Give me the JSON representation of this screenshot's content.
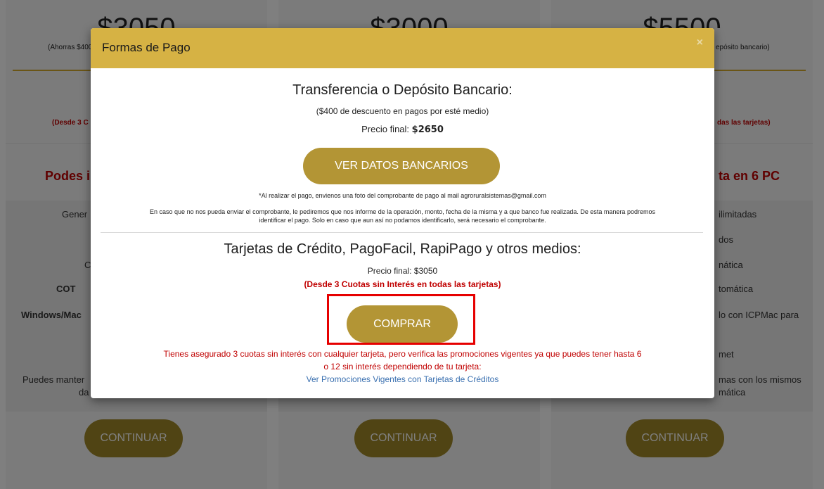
{
  "background": {
    "cards": [
      {
        "price": "$3050",
        "subnote": "(Ahorras $400",
        "rednote": "(Desde 3 C",
        "heading": "Podes i",
        "features": [
          "Gener",
          "C",
          "COT",
          "Windows/Mac",
          "Puedes manter",
          "da"
        ],
        "button": "CONTINUAR"
      },
      {
        "price": "$3000",
        "subnote": "",
        "rednote": "",
        "heading": "",
        "features": [],
        "button": "CONTINUAR"
      },
      {
        "price": "$5500",
        "subnote": "epósito bancario)",
        "rednote": "das las tarjetas)",
        "heading": "ta en 6 PC",
        "features": [
          "ilimitadas",
          "dos",
          "nática",
          "tomática",
          "lo con ICPMac para",
          "met",
          "mas con los mismos",
          "mática"
        ],
        "button": "CONTINUAR"
      }
    ]
  },
  "modal": {
    "title": "Formas de Pago",
    "close": "×",
    "transfer": {
      "title": "Transferencia o Depósito Bancario:",
      "discount": "($400 de descuento en pagos por esté medio)",
      "final_label": "Precio final: ",
      "final_value": "$2650",
      "button": "VER DATOS BANCARIOS",
      "note1": "*Al realizar el pago, envienos una foto del comprobante de pago al mail agroruralsistemas@gmail.com",
      "note2a": "En caso que no nos pueda enviar el comprobante, le pediremos que nos informe de la operación, monto, fecha de la misma y a que banco fue realizada. De esta manera podremos",
      "note2b": "identificar el pago. Solo en caso que aun así no podamos identificarlo, será necesario el comprobante."
    },
    "cards": {
      "title": "Tarjetas de Crédito, PagoFacil, RapiPago y otros medios:",
      "final": "Precio final: $3050",
      "installments": "(Desde 3 Cuotas sin Interés en todas las tarjetas)",
      "button": "COMPRAR",
      "warning1": "Tienes asegurado 3 cuotas sin interés con cualquier tarjeta, pero verifica las promociones vigentes ya que puedes tener hasta 6",
      "warning2": "o 12 sin interés dependiendo de tu tarjeta:",
      "promo_link": "Ver Promociones Vigentes con Tarjetas de Créditos"
    }
  },
  "colors": {
    "header_gold": "#d6b244",
    "button_gold": "#b39535",
    "red_text": "#c00000",
    "highlight": "#e60000",
    "link": "#3a70b0"
  }
}
